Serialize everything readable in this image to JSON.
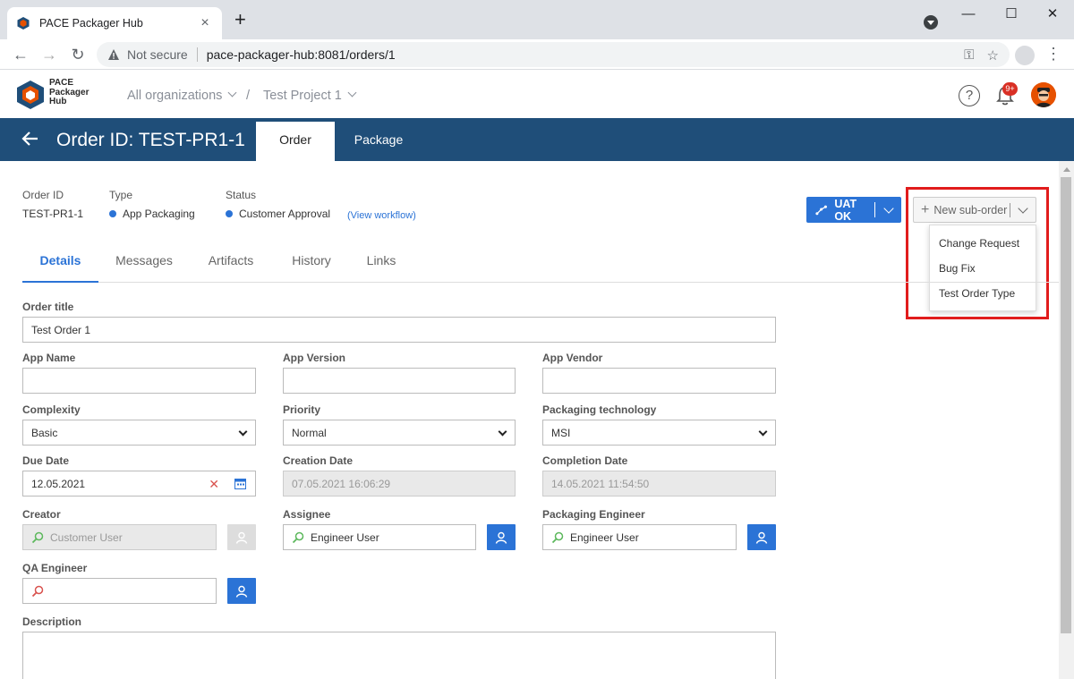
{
  "browser": {
    "tab_title": "PACE Packager Hub",
    "tab_close": "×",
    "new_tab": "+",
    "security_label": "Not secure",
    "url": "pace-packager-hub:8081/orders/1",
    "window_controls": {
      "minimize": "—",
      "maximize": "☐",
      "close": "✕"
    }
  },
  "app": {
    "logo_text": [
      "PACE",
      "Packager",
      "Hub"
    ],
    "breadcrumb": {
      "organization": "All organizations",
      "separator": "/",
      "project": "Test Project 1"
    },
    "help": "?",
    "notifications_badge": "9+"
  },
  "order_bar": {
    "title": "Order ID: TEST-PR1-1",
    "tabs": [
      {
        "label": "Order",
        "active": true
      },
      {
        "label": "Package",
        "active": false
      }
    ]
  },
  "summary": {
    "order_id_label": "Order ID",
    "order_id_value": "TEST-PR1-1",
    "type_label": "Type",
    "type_value": "App Packaging",
    "status_label": "Status",
    "status_value": "Customer Approval",
    "view_workflow": "(View workflow)",
    "status_color": "#2b73d6"
  },
  "actions": {
    "uat_label": "UAT OK",
    "new_suborder_label": "New sub-order",
    "suborder_menu": [
      "Change Request",
      "Bug Fix",
      "Test Order Type"
    ],
    "highlight_color": "#e11c1c"
  },
  "subtabs": [
    {
      "label": "Details",
      "active": true
    },
    {
      "label": "Messages",
      "active": false
    },
    {
      "label": "Artifacts",
      "active": false
    },
    {
      "label": "History",
      "active": false
    },
    {
      "label": "Links",
      "active": false
    }
  ],
  "form": {
    "order_title": {
      "label": "Order title",
      "value": "Test Order 1"
    },
    "app_name": {
      "label": "App Name",
      "value": ""
    },
    "app_version": {
      "label": "App Version",
      "value": ""
    },
    "app_vendor": {
      "label": "App Vendor",
      "value": ""
    },
    "complexity": {
      "label": "Complexity",
      "value": "Basic"
    },
    "priority": {
      "label": "Priority",
      "value": "Normal"
    },
    "packaging_technology": {
      "label": "Packaging technology",
      "value": "MSI"
    },
    "due_date": {
      "label": "Due Date",
      "value": "12.05.2021"
    },
    "creation_date": {
      "label": "Creation Date",
      "value": "07.05.2021 16:06:29"
    },
    "completion_date": {
      "label": "Completion Date",
      "value": "14.05.2021 11:54:50"
    },
    "creator": {
      "label": "Creator",
      "value": "Customer User"
    },
    "assignee": {
      "label": "Assignee",
      "value": "Engineer User"
    },
    "packaging_engineer": {
      "label": "Packaging Engineer",
      "value": "Engineer User"
    },
    "qa_engineer": {
      "label": "QA Engineer",
      "value": ""
    },
    "description": {
      "label": "Description",
      "value": ""
    }
  },
  "colors": {
    "primary": "#2b73d6",
    "header": "#1f4e79",
    "accent": "#e65100"
  }
}
